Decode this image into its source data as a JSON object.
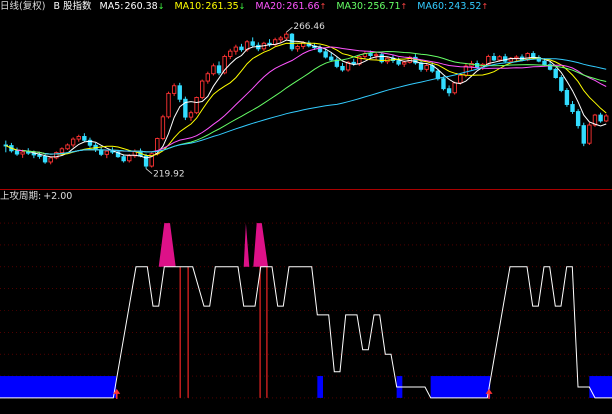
{
  "upper_header": {
    "period": "日线(复权)",
    "stock": "B 股指数",
    "ma": [
      {
        "label": "MA5:",
        "value": "260.38",
        "arrow": "↓",
        "color": "#ffffff"
      },
      {
        "label": "MA10:",
        "value": "261.35",
        "arrow": "↓",
        "color": "#ffff00"
      },
      {
        "label": "MA20:",
        "value": "261.66",
        "arrow": "↑",
        "color": "#ff55ff"
      },
      {
        "label": "MA30:",
        "value": "256.71",
        "arrow": "↑",
        "color": "#66ff66"
      },
      {
        "label": "MA60:",
        "value": "243.52",
        "arrow": "↑",
        "color": "#33ccff"
      }
    ]
  },
  "lower_header": {
    "name": "上攻周期:",
    "value": "+2.00"
  },
  "colors": {
    "background": "#000000",
    "up_candle": "#ff3333",
    "down_candle": "#33ddff",
    "cycle_line": "#ffffff",
    "fill_high": "#dd1188",
    "fill_low": "#0000ff",
    "signal_bar": "#dd2222",
    "signal_arrow": "#ff3333",
    "grid": "#800000"
  },
  "chart_data": [
    {
      "type": "candlestick",
      "title": "B 股指数",
      "annotations": [
        {
          "text": "266.46",
          "kind": "max",
          "index": 50
        },
        {
          "text": "219.92",
          "kind": "min",
          "index": 25
        }
      ],
      "ylim": [
        214,
        272
      ],
      "candles": [
        [
          228.0,
          229.5,
          225.5,
          227.8
        ],
        [
          227.8,
          228.7,
          225.4,
          226.0
        ],
        [
          226.0,
          227.1,
          224.3,
          224.9
        ],
        [
          224.9,
          226.4,
          223.6,
          225.6
        ],
        [
          225.6,
          226.9,
          224.6,
          225.2
        ],
        [
          225.2,
          226.1,
          223.5,
          224.6
        ],
        [
          224.6,
          225.7,
          223.3,
          224.1
        ],
        [
          224.1,
          225.1,
          221.6,
          222.2
        ],
        [
          222.2,
          224.0,
          221.4,
          223.6
        ],
        [
          223.6,
          225.8,
          223.1,
          225.4
        ],
        [
          225.4,
          227.2,
          225.0,
          226.7
        ],
        [
          226.7,
          228.5,
          226.3,
          228.0
        ],
        [
          228.0,
          230.6,
          227.2,
          230.0
        ],
        [
          230.0,
          231.5,
          229.1,
          230.9
        ],
        [
          230.9,
          232.0,
          229.0,
          229.6
        ],
        [
          229.6,
          230.5,
          227.1,
          227.9
        ],
        [
          227.9,
          228.7,
          225.6,
          226.3
        ],
        [
          226.3,
          227.5,
          224.2,
          224.8
        ],
        [
          224.8,
          226.4,
          223.5,
          225.9
        ],
        [
          225.9,
          227.2,
          224.9,
          225.6
        ],
        [
          225.6,
          226.3,
          223.6,
          224.0
        ],
        [
          224.0,
          224.8,
          222.0,
          222.6
        ],
        [
          222.6,
          224.9,
          222.0,
          224.3
        ],
        [
          224.3,
          226.5,
          223.6,
          225.9
        ],
        [
          225.9,
          226.8,
          223.8,
          224.2
        ],
        [
          224.2,
          225.0,
          219.9,
          220.8
        ],
        [
          220.8,
          225.4,
          220.3,
          225.0
        ],
        [
          225.0,
          230.5,
          224.4,
          230.2
        ],
        [
          230.2,
          238.3,
          229.6,
          237.6
        ],
        [
          237.6,
          246.2,
          237.0,
          245.6
        ],
        [
          245.6,
          249.0,
          244.7,
          248.2
        ],
        [
          248.2,
          249.2,
          242.6,
          243.6
        ],
        [
          243.6,
          244.5,
          236.5,
          237.5
        ],
        [
          237.5,
          239.7,
          236.2,
          239.0
        ],
        [
          239.0,
          244.5,
          238.5,
          244.2
        ],
        [
          244.2,
          250.3,
          243.6,
          249.8
        ],
        [
          249.8,
          253.0,
          248.9,
          252.3
        ],
        [
          252.3,
          255.8,
          251.7,
          255.0
        ],
        [
          255.0,
          256.5,
          251.8,
          252.6
        ],
        [
          252.6,
          258.8,
          252.1,
          258.2
        ],
        [
          258.2,
          260.8,
          257.3,
          260.0
        ],
        [
          260.0,
          262.2,
          258.8,
          261.4
        ],
        [
          261.4,
          262.5,
          259.8,
          260.5
        ],
        [
          260.5,
          263.8,
          259.8,
          263.2
        ],
        [
          263.2,
          264.7,
          261.5,
          262.0
        ],
        [
          262.0,
          263.0,
          260.0,
          260.8
        ],
        [
          260.8,
          263.2,
          260.1,
          262.7
        ],
        [
          262.7,
          264.1,
          261.5,
          262.2
        ],
        [
          262.2,
          264.6,
          261.7,
          263.9
        ],
        [
          263.9,
          265.2,
          263.0,
          264.5
        ],
        [
          264.5,
          266.46,
          263.6,
          265.8
        ],
        [
          265.8,
          266.2,
          260.0,
          260.8
        ],
        [
          260.8,
          262.2,
          259.8,
          261.6
        ],
        [
          261.6,
          263.4,
          260.7,
          262.8
        ],
        [
          262.8,
          263.6,
          261.3,
          261.8
        ],
        [
          261.8,
          262.6,
          260.4,
          261.2
        ],
        [
          261.2,
          262.0,
          259.3,
          259.8
        ],
        [
          259.8,
          260.9,
          257.5,
          258.0
        ],
        [
          258.0,
          259.6,
          256.4,
          257.0
        ],
        [
          257.0,
          257.9,
          254.2,
          254.8
        ],
        [
          254.8,
          256.0,
          253.0,
          253.6
        ],
        [
          253.6,
          256.6,
          253.0,
          256.2
        ],
        [
          256.2,
          257.4,
          255.0,
          255.6
        ],
        [
          255.6,
          258.6,
          255.0,
          258.2
        ],
        [
          258.2,
          259.9,
          257.5,
          259.2
        ],
        [
          259.2,
          260.2,
          257.8,
          258.5
        ],
        [
          258.5,
          259.6,
          257.2,
          258.8
        ],
        [
          258.8,
          259.5,
          255.8,
          256.4
        ],
        [
          256.4,
          258.0,
          255.6,
          257.6
        ],
        [
          257.6,
          258.7,
          256.0,
          256.8
        ],
        [
          256.8,
          257.8,
          255.0,
          255.6
        ],
        [
          255.6,
          256.8,
          254.6,
          256.2
        ],
        [
          256.2,
          258.4,
          255.8,
          257.9
        ],
        [
          257.9,
          259.0,
          255.4,
          256.0
        ],
        [
          256.0,
          256.9,
          253.0,
          253.8
        ],
        [
          253.8,
          255.6,
          253.0,
          255.1
        ],
        [
          255.1,
          256.2,
          252.6,
          253.2
        ],
        [
          253.2,
          254.0,
          250.0,
          250.6
        ],
        [
          250.6,
          251.4,
          246.6,
          247.2
        ],
        [
          247.2,
          248.3,
          244.6,
          245.8
        ],
        [
          245.8,
          249.6,
          245.2,
          249.2
        ],
        [
          249.2,
          252.4,
          248.6,
          251.8
        ],
        [
          251.8,
          255.6,
          251.1,
          254.9
        ],
        [
          254.9,
          256.7,
          253.6,
          255.8
        ],
        [
          255.8,
          256.8,
          254.0,
          254.6
        ],
        [
          254.6,
          256.0,
          253.6,
          255.5
        ],
        [
          255.5,
          258.8,
          255.0,
          258.2
        ],
        [
          258.2,
          259.4,
          256.6,
          257.0
        ],
        [
          257.0,
          258.6,
          256.4,
          258.1
        ],
        [
          258.1,
          259.1,
          256.0,
          256.6
        ],
        [
          256.6,
          258.0,
          255.9,
          257.6
        ],
        [
          257.6,
          258.6,
          256.8,
          258.0
        ],
        [
          258.0,
          258.9,
          256.5,
          257.0
        ],
        [
          257.0,
          259.6,
          256.6,
          259.2
        ],
        [
          259.2,
          260.0,
          257.4,
          257.8
        ],
        [
          257.8,
          258.6,
          256.2,
          256.6
        ],
        [
          256.6,
          257.6,
          255.0,
          255.4
        ],
        [
          255.4,
          256.6,
          253.4,
          253.8
        ],
        [
          253.8,
          254.4,
          250.6,
          251.0
        ],
        [
          251.0,
          251.8,
          246.0,
          246.6
        ],
        [
          246.6,
          247.4,
          241.0,
          241.8
        ],
        [
          241.8,
          243.0,
          238.6,
          239.4
        ],
        [
          239.4,
          240.2,
          233.6,
          234.6
        ],
        [
          234.6,
          235.6,
          227.6,
          228.6
        ],
        [
          228.6,
          235.6,
          228.0,
          234.8
        ],
        [
          234.8,
          238.6,
          234.2,
          238.2
        ],
        [
          238.2,
          239.0,
          235.6,
          236.2
        ],
        [
          236.2,
          238.6,
          235.8,
          237.9
        ]
      ],
      "ma_series": [
        {
          "name": "MA5",
          "period": 5
        },
        {
          "name": "MA10",
          "period": 10
        },
        {
          "name": "MA20",
          "period": 20
        },
        {
          "name": "MA30",
          "period": 30
        },
        {
          "name": "MA60",
          "period": 60
        }
      ]
    },
    {
      "type": "area",
      "title": "上攻周期",
      "ylim": [
        -0.6,
        8.6
      ],
      "y_ticks": [
        0,
        1,
        2,
        3,
        4,
        5,
        6,
        7,
        8
      ],
      "x_start": 0,
      "x_end": 108,
      "line": [
        [
          0,
          0
        ],
        [
          20,
          0
        ],
        [
          24,
          6.0
        ],
        [
          26,
          6.0
        ],
        [
          27,
          4.2
        ],
        [
          28,
          4.2
        ],
        [
          29,
          6.0
        ],
        [
          34,
          6.0
        ],
        [
          36,
          4.2
        ],
        [
          37,
          4.2
        ],
        [
          38,
          6.0
        ],
        [
          42,
          6.0
        ],
        [
          43,
          4.2
        ],
        [
          45,
          4.2
        ],
        [
          46,
          6.0
        ],
        [
          48,
          6.0
        ],
        [
          49,
          4.2
        ],
        [
          50,
          4.2
        ],
        [
          51,
          6.0
        ],
        [
          55,
          6.0
        ],
        [
          56,
          3.8
        ],
        [
          58,
          3.8
        ],
        [
          59,
          1.2
        ],
        [
          60,
          1.2
        ],
        [
          61,
          3.8
        ],
        [
          63,
          3.8
        ],
        [
          64,
          2.2
        ],
        [
          65,
          2.2
        ],
        [
          66,
          3.8
        ],
        [
          67,
          3.8
        ],
        [
          68,
          2.0
        ],
        [
          69,
          2.0
        ],
        [
          70,
          0.5
        ],
        [
          75,
          0.5
        ],
        [
          76,
          0
        ],
        [
          86,
          0
        ],
        [
          90,
          6.0
        ],
        [
          93,
          6.0
        ],
        [
          94,
          4.2
        ],
        [
          95,
          4.2
        ],
        [
          96,
          6.0
        ],
        [
          97,
          6.0
        ],
        [
          98,
          4.2
        ],
        [
          99,
          4.2
        ],
        [
          100,
          6.0
        ],
        [
          101,
          6.0
        ],
        [
          102,
          0.5
        ],
        [
          104,
          0.5
        ],
        [
          105,
          0
        ],
        [
          108,
          0
        ]
      ],
      "high_fills": [
        {
          "points": [
            [
              29,
              8.0
            ],
            [
              30,
              8.0
            ],
            [
              31,
              6.0
            ],
            [
              28,
              6.0
            ]
          ]
        },
        {
          "points": [
            [
              43.4,
              8.0
            ],
            [
              44,
              6.0
            ],
            [
              43,
              6.0
            ]
          ]
        },
        {
          "points": [
            [
              45.3,
              8.0
            ],
            [
              46.2,
              8.0
            ],
            [
              47.3,
              6.0
            ],
            [
              44.7,
              6.0
            ]
          ]
        }
      ],
      "low_fills": [
        {
          "from": 0,
          "to": 20.5
        },
        {
          "from": 56,
          "to": 57
        },
        {
          "from": 70,
          "to": 71
        },
        {
          "from": 76,
          "to": 86.5
        },
        {
          "from": 104,
          "to": 108
        }
      ],
      "signal_bars": [
        {
          "x": 31.8,
          "top": 6.0
        },
        {
          "x": 33.2,
          "top": 6.0
        },
        {
          "x": 45.9,
          "top": 6.0
        },
        {
          "x": 47.1,
          "top": 6.0
        }
      ],
      "signal_arrows": [
        20.6,
        86.3
      ]
    }
  ]
}
